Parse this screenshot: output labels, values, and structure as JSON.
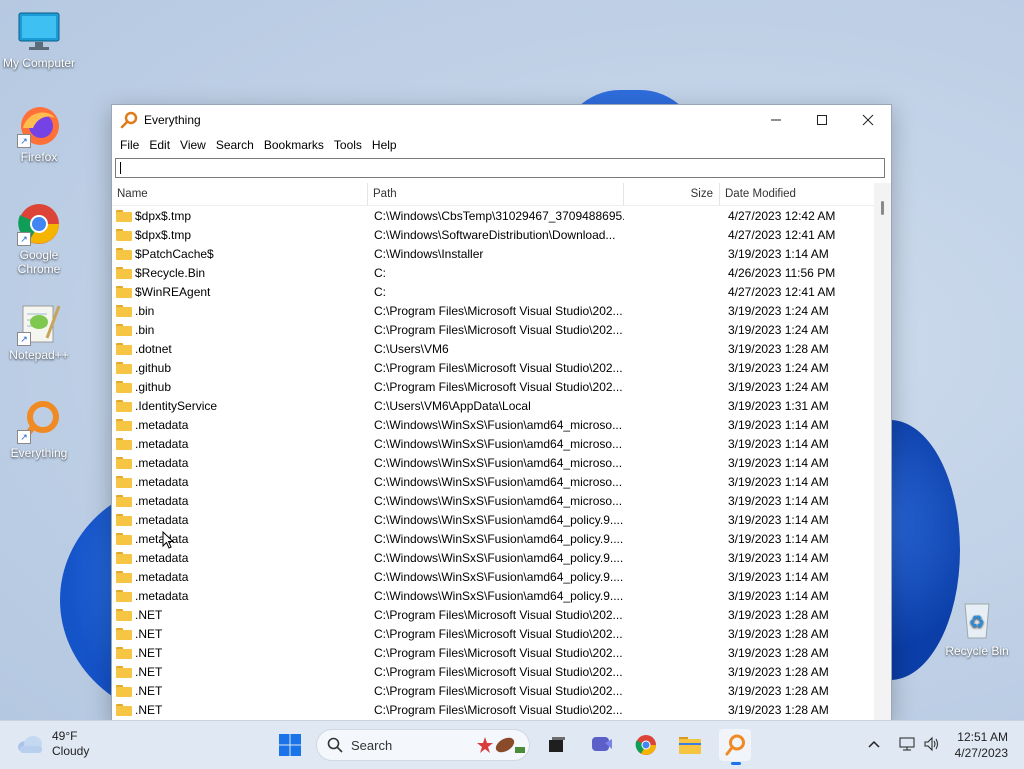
{
  "desktop": {
    "icons": [
      {
        "label": "My Computer"
      },
      {
        "label": "Firefox"
      },
      {
        "label": "Google Chrome"
      },
      {
        "label": "Notepad++"
      },
      {
        "label": "Everything"
      },
      {
        "label": "Recycle Bin"
      }
    ]
  },
  "window": {
    "title": "Everything",
    "menu": [
      "File",
      "Edit",
      "View",
      "Search",
      "Bookmarks",
      "Tools",
      "Help"
    ],
    "search": {
      "value": ""
    },
    "columns": {
      "name": "Name",
      "path": "Path",
      "size": "Size",
      "date": "Date Modified"
    },
    "rows": [
      {
        "name": "$dpx$.tmp",
        "path": "C:\\Windows\\CbsTemp\\31029467_3709488695...",
        "size": "",
        "date": "4/27/2023 12:42 AM"
      },
      {
        "name": "$dpx$.tmp",
        "path": "C:\\Windows\\SoftwareDistribution\\Download...",
        "size": "",
        "date": "4/27/2023 12:41 AM"
      },
      {
        "name": "$PatchCache$",
        "path": "C:\\Windows\\Installer",
        "size": "",
        "date": "3/19/2023 1:14 AM"
      },
      {
        "name": "$Recycle.Bin",
        "path": "C:",
        "size": "",
        "date": "4/26/2023 11:56 PM"
      },
      {
        "name": "$WinREAgent",
        "path": "C:",
        "size": "",
        "date": "4/27/2023 12:41 AM"
      },
      {
        "name": ".bin",
        "path": "C:\\Program Files\\Microsoft Visual Studio\\202...",
        "size": "",
        "date": "3/19/2023 1:24 AM"
      },
      {
        "name": ".bin",
        "path": "C:\\Program Files\\Microsoft Visual Studio\\202...",
        "size": "",
        "date": "3/19/2023 1:24 AM"
      },
      {
        "name": ".dotnet",
        "path": "C:\\Users\\VM6",
        "size": "",
        "date": "3/19/2023 1:28 AM"
      },
      {
        "name": ".github",
        "path": "C:\\Program Files\\Microsoft Visual Studio\\202...",
        "size": "",
        "date": "3/19/2023 1:24 AM"
      },
      {
        "name": ".github",
        "path": "C:\\Program Files\\Microsoft Visual Studio\\202...",
        "size": "",
        "date": "3/19/2023 1:24 AM"
      },
      {
        "name": ".IdentityService",
        "path": "C:\\Users\\VM6\\AppData\\Local",
        "size": "",
        "date": "3/19/2023 1:31 AM"
      },
      {
        "name": ".metadata",
        "path": "C:\\Windows\\WinSxS\\Fusion\\amd64_microso...",
        "size": "",
        "date": "3/19/2023 1:14 AM"
      },
      {
        "name": ".metadata",
        "path": "C:\\Windows\\WinSxS\\Fusion\\amd64_microso...",
        "size": "",
        "date": "3/19/2023 1:14 AM"
      },
      {
        "name": ".metadata",
        "path": "C:\\Windows\\WinSxS\\Fusion\\amd64_microso...",
        "size": "",
        "date": "3/19/2023 1:14 AM"
      },
      {
        "name": ".metadata",
        "path": "C:\\Windows\\WinSxS\\Fusion\\amd64_microso...",
        "size": "",
        "date": "3/19/2023 1:14 AM"
      },
      {
        "name": ".metadata",
        "path": "C:\\Windows\\WinSxS\\Fusion\\amd64_microso...",
        "size": "",
        "date": "3/19/2023 1:14 AM"
      },
      {
        "name": ".metadata",
        "path": "C:\\Windows\\WinSxS\\Fusion\\amd64_policy.9....",
        "size": "",
        "date": "3/19/2023 1:14 AM"
      },
      {
        "name": ".metadata",
        "path": "C:\\Windows\\WinSxS\\Fusion\\amd64_policy.9....",
        "size": "",
        "date": "3/19/2023 1:14 AM"
      },
      {
        "name": ".metadata",
        "path": "C:\\Windows\\WinSxS\\Fusion\\amd64_policy.9....",
        "size": "",
        "date": "3/19/2023 1:14 AM"
      },
      {
        "name": ".metadata",
        "path": "C:\\Windows\\WinSxS\\Fusion\\amd64_policy.9....",
        "size": "",
        "date": "3/19/2023 1:14 AM"
      },
      {
        "name": ".metadata",
        "path": "C:\\Windows\\WinSxS\\Fusion\\amd64_policy.9....",
        "size": "",
        "date": "3/19/2023 1:14 AM"
      },
      {
        "name": ".NET",
        "path": "C:\\Program Files\\Microsoft Visual Studio\\202...",
        "size": "",
        "date": "3/19/2023 1:28 AM"
      },
      {
        "name": ".NET",
        "path": "C:\\Program Files\\Microsoft Visual Studio\\202...",
        "size": "",
        "date": "3/19/2023 1:28 AM"
      },
      {
        "name": ".NET",
        "path": "C:\\Program Files\\Microsoft Visual Studio\\202...",
        "size": "",
        "date": "3/19/2023 1:28 AM"
      },
      {
        "name": ".NET",
        "path": "C:\\Program Files\\Microsoft Visual Studio\\202...",
        "size": "",
        "date": "3/19/2023 1:28 AM"
      },
      {
        "name": ".NET",
        "path": "C:\\Program Files\\Microsoft Visual Studio\\202...",
        "size": "",
        "date": "3/19/2023 1:28 AM"
      },
      {
        "name": ".NET",
        "path": "C:\\Program Files\\Microsoft Visual Studio\\202...",
        "size": "",
        "date": "3/19/2023 1:28 AM"
      }
    ]
  },
  "taskbar": {
    "weather": {
      "temp": "49°F",
      "condition": "Cloudy"
    },
    "search_label": "Search",
    "apps": [
      "task-view-icon",
      "meet-icon",
      "chrome-icon",
      "file-explorer-icon",
      "everything-icon"
    ],
    "clock": {
      "time": "12:51 AM",
      "date": "4/27/2023"
    }
  },
  "colors": {
    "accent": "#1a73e8",
    "folder": "#f7c544",
    "taskbar": "#dfe8f3"
  }
}
